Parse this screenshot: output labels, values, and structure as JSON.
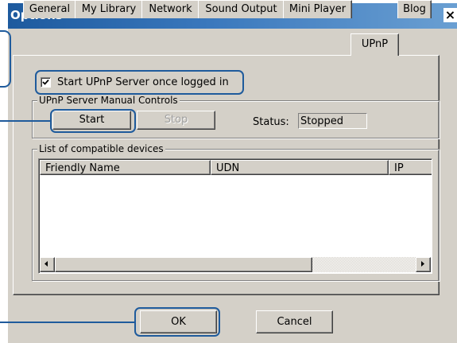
{
  "window": {
    "title": "Options",
    "close_label": "×"
  },
  "tabs": [
    {
      "label": "General",
      "active": false
    },
    {
      "label": "My Library",
      "active": false
    },
    {
      "label": "Network",
      "active": false
    },
    {
      "label": "Sound Output",
      "active": false
    },
    {
      "label": "Mini Player",
      "active": false
    },
    {
      "label": "UPnP",
      "active": true
    },
    {
      "label": "Blog",
      "active": false
    }
  ],
  "upnp": {
    "start_on_login": {
      "label": "Start UPnP Server once logged in",
      "checked": true
    },
    "manual_controls": {
      "title": "UPnP Server Manual Controls",
      "start_label": "Start",
      "stop_label": "Stop",
      "stop_enabled": false,
      "status_label": "Status:",
      "status_value": "Stopped"
    },
    "devices": {
      "title": "List of compatible devices",
      "columns": [
        "Friendly Name",
        "UDN",
        "IP"
      ],
      "rows": []
    }
  },
  "footer": {
    "ok_label": "OK",
    "cancel_label": "Cancel"
  },
  "colors": {
    "callout": "#1f5b9c",
    "titlebar_start": "#1d5a9e",
    "titlebar_end": "#6a9fd2",
    "face": "#d4d0c8"
  }
}
